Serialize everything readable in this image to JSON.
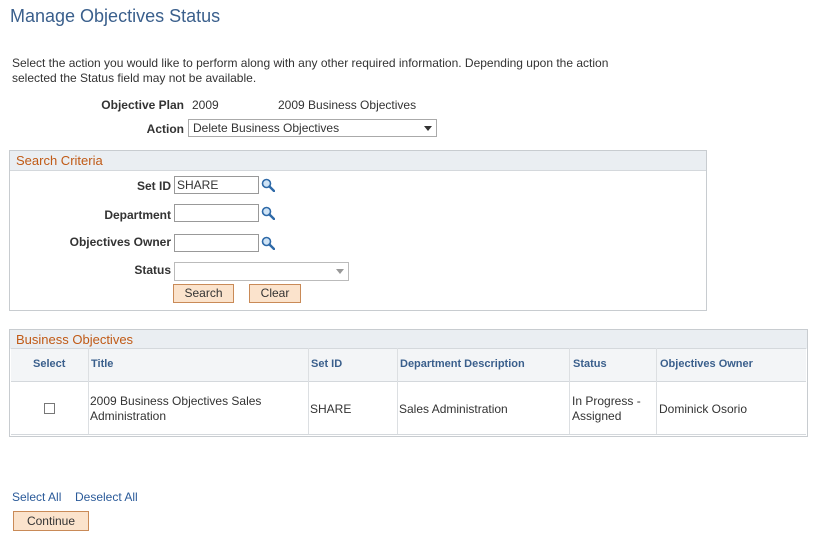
{
  "page": {
    "title": "Manage Objectives Status",
    "intro": "Select the action you would like to perform along with any other required information. Depending upon the action selected the Status field may not be available."
  },
  "plan": {
    "label": "Objective Plan",
    "year": "2009",
    "description": "2009 Business Objectives",
    "action_label": "Action",
    "action_value": "Delete Business Objectives"
  },
  "search": {
    "heading": "Search Criteria",
    "setid_label": "Set ID",
    "setid_value": "SHARE",
    "department_label": "Department",
    "department_value": "",
    "owner_label": "Objectives Owner",
    "owner_value": "",
    "status_label": "Status",
    "status_value": "",
    "search_button": "Search",
    "clear_button": "Clear"
  },
  "grid": {
    "heading": "Business Objectives",
    "columns": [
      "Select",
      "Title",
      "Set ID",
      "Department Description",
      "Status",
      "Objectives Owner"
    ],
    "rows": [
      {
        "title": "2009 Business Objectives Sales Administration",
        "setid": "SHARE",
        "department": "Sales Administration",
        "status": "In Progress - Assigned",
        "owner": "Dominick Osorio",
        "selected": false
      }
    ]
  },
  "footer": {
    "select_all": "Select All",
    "deselect_all": "Deselect All",
    "continue_button": "Continue"
  },
  "icons": [
    "lookup-magnifier-icon",
    "dropdown-arrow-icon",
    "checkbox-icon"
  ],
  "colors": {
    "title": "#3a5f8c",
    "section_heading": "#c05a16",
    "link": "#2a5a99",
    "button_bg": "#fbe3cc"
  }
}
